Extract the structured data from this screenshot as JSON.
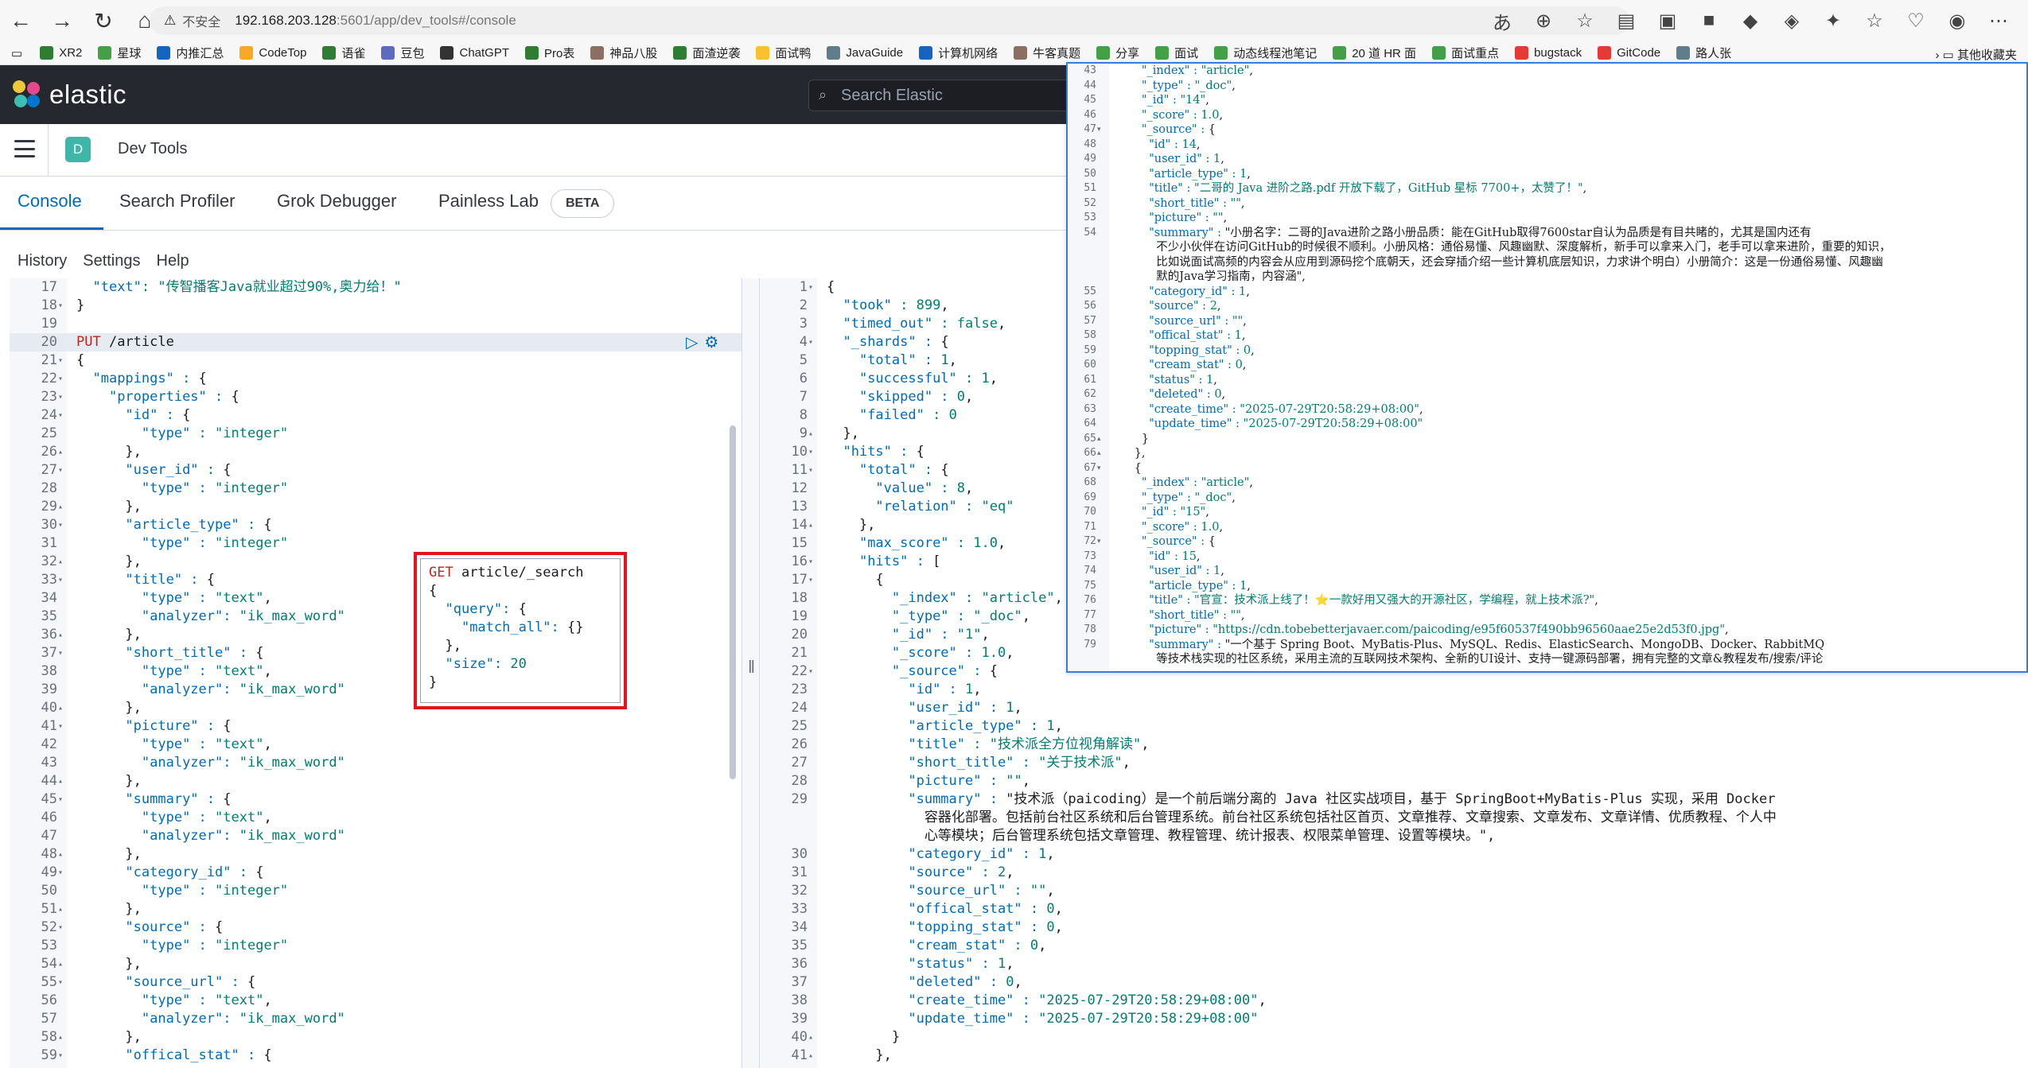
{
  "browser": {
    "insecure_label": "不安全",
    "url_host": "192.168.203.128",
    "url_path": ":5601/app/dev_tools#/console",
    "bookmarks": [
      {
        "label": "XR2",
        "color": "#2e7d32"
      },
      {
        "label": "星球",
        "color": "#43a047"
      },
      {
        "label": "内推汇总",
        "color": "#1565c0"
      },
      {
        "label": "CodeTop",
        "color": "#f9a825"
      },
      {
        "label": "语雀",
        "color": "#2e7d32"
      },
      {
        "label": "豆包",
        "color": "#5c6bc0"
      },
      {
        "label": "ChatGPT",
        "color": "#333333"
      },
      {
        "label": "Pro表",
        "color": "#2e7d32"
      },
      {
        "label": "神品八股",
        "color": "#8d6e63"
      },
      {
        "label": "面渣逆袭",
        "color": "#2e7d32"
      },
      {
        "label": "面试鸭",
        "color": "#fbc02d"
      },
      {
        "label": "JavaGuide",
        "color": "#607d8b"
      },
      {
        "label": "计算机网络",
        "color": "#1565c0"
      },
      {
        "label": "牛客真题",
        "color": "#8d6e63"
      },
      {
        "label": "分享",
        "color": "#43a047"
      },
      {
        "label": "面试",
        "color": "#43a047"
      },
      {
        "label": "动态线程池笔记",
        "color": "#43a047"
      },
      {
        "label": "20 道 HR 面",
        "color": "#43a047"
      },
      {
        "label": "面试重点",
        "color": "#43a047"
      },
      {
        "label": "bugstack",
        "color": "#e53935"
      },
      {
        "label": "GitCode",
        "color": "#e53935"
      },
      {
        "label": "路人张",
        "color": "#607d8b"
      }
    ],
    "other_bookmarks": "其他收藏夹"
  },
  "kibana": {
    "logo_text": "elastic",
    "search_placeholder": "Search Elastic",
    "app_badge": "D",
    "app_title": "Dev Tools",
    "tabs": [
      "Console",
      "Search Profiler",
      "Grok Debugger",
      "Painless Lab"
    ],
    "beta": "BETA",
    "subnav": [
      "History",
      "Settings",
      "Help"
    ]
  },
  "left_editor": [
    {
      "n": "17",
      "f": "",
      "t": "  \"text\": \"传智播客Java就业超过90%,奥力给！\""
    },
    {
      "n": "18",
      "f": "▾",
      "t": "}"
    },
    {
      "n": "19",
      "f": "",
      "t": ""
    },
    {
      "n": "20",
      "f": "",
      "t": "PUT /article",
      "hl": true
    },
    {
      "n": "21",
      "f": "▾",
      "t": "{"
    },
    {
      "n": "22",
      "f": "▾",
      "t": "  \"mappings\" : {"
    },
    {
      "n": "23",
      "f": "▾",
      "t": "    \"properties\" : {"
    },
    {
      "n": "24",
      "f": "▾",
      "t": "      \"id\" : {"
    },
    {
      "n": "25",
      "f": "",
      "t": "        \"type\" : \"integer\""
    },
    {
      "n": "26",
      "f": "▴",
      "t": "      },"
    },
    {
      "n": "27",
      "f": "▾",
      "t": "      \"user_id\" : {"
    },
    {
      "n": "28",
      "f": "",
      "t": "        \"type\" : \"integer\""
    },
    {
      "n": "29",
      "f": "▴",
      "t": "      },"
    },
    {
      "n": "30",
      "f": "▾",
      "t": "      \"article_type\" : {"
    },
    {
      "n": "31",
      "f": "",
      "t": "        \"type\" : \"integer\""
    },
    {
      "n": "32",
      "f": "▴",
      "t": "      },"
    },
    {
      "n": "33",
      "f": "▾",
      "t": "      \"title\" : {"
    },
    {
      "n": "34",
      "f": "",
      "t": "        \"type\" : \"text\","
    },
    {
      "n": "35",
      "f": "",
      "t": "        \"analyzer\": \"ik_max_word\""
    },
    {
      "n": "36",
      "f": "▴",
      "t": "      },"
    },
    {
      "n": "37",
      "f": "▾",
      "t": "      \"short_title\" : {"
    },
    {
      "n": "38",
      "f": "",
      "t": "        \"type\" : \"text\","
    },
    {
      "n": "39",
      "f": "",
      "t": "        \"analyzer\": \"ik_max_word\""
    },
    {
      "n": "40",
      "f": "▴",
      "t": "      },"
    },
    {
      "n": "41",
      "f": "▾",
      "t": "      \"picture\" : {"
    },
    {
      "n": "42",
      "f": "",
      "t": "        \"type\" : \"text\","
    },
    {
      "n": "43",
      "f": "",
      "t": "        \"analyzer\": \"ik_max_word\""
    },
    {
      "n": "44",
      "f": "▴",
      "t": "      },"
    },
    {
      "n": "45",
      "f": "▾",
      "t": "      \"summary\" : {"
    },
    {
      "n": "46",
      "f": "",
      "t": "        \"type\" : \"text\","
    },
    {
      "n": "47",
      "f": "",
      "t": "        \"analyzer\": \"ik_max_word\""
    },
    {
      "n": "48",
      "f": "▴",
      "t": "      },"
    },
    {
      "n": "49",
      "f": "▾",
      "t": "      \"category_id\" : {"
    },
    {
      "n": "50",
      "f": "",
      "t": "        \"type\" : \"integer\""
    },
    {
      "n": "51",
      "f": "▴",
      "t": "      },"
    },
    {
      "n": "52",
      "f": "▾",
      "t": "      \"source\" : {"
    },
    {
      "n": "53",
      "f": "",
      "t": "        \"type\" : \"integer\""
    },
    {
      "n": "54",
      "f": "▴",
      "t": "      },"
    },
    {
      "n": "55",
      "f": "▾",
      "t": "      \"source_url\" : {"
    },
    {
      "n": "56",
      "f": "",
      "t": "        \"type\" : \"text\","
    },
    {
      "n": "57",
      "f": "",
      "t": "        \"analyzer\": \"ik_max_word\""
    },
    {
      "n": "58",
      "f": "▴",
      "t": "      },"
    },
    {
      "n": "59",
      "f": "▾",
      "t": "      \"offical_stat\" : {"
    }
  ],
  "popup_query": [
    "GET article/_search",
    "{",
    "  \"query\": {",
    "    \"match_all\": {}",
    "  },",
    "  \"size\": 20",
    "}"
  ],
  "right_editor": [
    {
      "n": "1",
      "f": "▾",
      "t": "{"
    },
    {
      "n": "2",
      "f": "",
      "t": "  \"took\" : 899,"
    },
    {
      "n": "3",
      "f": "",
      "t": "  \"timed_out\" : false,"
    },
    {
      "n": "4",
      "f": "▾",
      "t": "  \"_shards\" : {"
    },
    {
      "n": "5",
      "f": "",
      "t": "    \"total\" : 1,"
    },
    {
      "n": "6",
      "f": "",
      "t": "    \"successful\" : 1,"
    },
    {
      "n": "7",
      "f": "",
      "t": "    \"skipped\" : 0,"
    },
    {
      "n": "8",
      "f": "",
      "t": "    \"failed\" : 0"
    },
    {
      "n": "9",
      "f": "▴",
      "t": "  },"
    },
    {
      "n": "10",
      "f": "▾",
      "t": "  \"hits\" : {"
    },
    {
      "n": "11",
      "f": "▾",
      "t": "    \"total\" : {"
    },
    {
      "n": "12",
      "f": "",
      "t": "      \"value\" : 8,"
    },
    {
      "n": "13",
      "f": "",
      "t": "      \"relation\" : \"eq\""
    },
    {
      "n": "14",
      "f": "▴",
      "t": "    },"
    },
    {
      "n": "15",
      "f": "",
      "t": "    \"max_score\" : 1.0,"
    },
    {
      "n": "16",
      "f": "▾",
      "t": "    \"hits\" : ["
    },
    {
      "n": "17",
      "f": "▾",
      "t": "      {"
    },
    {
      "n": "18",
      "f": "",
      "t": "        \"_index\" : \"article\","
    },
    {
      "n": "19",
      "f": "",
      "t": "        \"_type\" : \"_doc\","
    },
    {
      "n": "20",
      "f": "",
      "t": "        \"_id\" : \"1\","
    },
    {
      "n": "21",
      "f": "",
      "t": "        \"_score\" : 1.0,"
    },
    {
      "n": "22",
      "f": "▾",
      "t": "        \"_source\" : {"
    },
    {
      "n": "23",
      "f": "",
      "t": "          \"id\" : 1,"
    },
    {
      "n": "24",
      "f": "",
      "t": "          \"user_id\" : 1,"
    },
    {
      "n": "25",
      "f": "",
      "t": "          \"article_type\" : 1,"
    },
    {
      "n": "26",
      "f": "",
      "t": "          \"title\" : \"技术派全方位视角解读\","
    },
    {
      "n": "27",
      "f": "",
      "t": "          \"short_title\" : \"关于技术派\","
    },
    {
      "n": "28",
      "f": "",
      "t": "          \"picture\" : \"\","
    },
    {
      "n": "29",
      "f": "",
      "t": "          \"summary\" : \"技术派（paicoding）是一个前后端分离的 Java 社区实战项目，基于 SpringBoot+MyBatis-Plus 实现，采用 Docker"
    },
    {
      "n": "",
      "f": "",
      "t": "            容器化部署。包括前台社区系统和后台管理系统。前台社区系统包括社区首页、文章推荐、文章搜索、文章发布、文章详情、优质教程、个人中"
    },
    {
      "n": "",
      "f": "",
      "t": "            心等模块；后台管理系统包括文章管理、教程管理、统计报表、权限菜单管理、设置等模块。\","
    },
    {
      "n": "30",
      "f": "",
      "t": "          \"category_id\" : 1,"
    },
    {
      "n": "31",
      "f": "",
      "t": "          \"source\" : 2,"
    },
    {
      "n": "32",
      "f": "",
      "t": "          \"source_url\" : \"\","
    },
    {
      "n": "33",
      "f": "",
      "t": "          \"offical_stat\" : 0,"
    },
    {
      "n": "34",
      "f": "",
      "t": "          \"topping_stat\" : 0,"
    },
    {
      "n": "35",
      "f": "",
      "t": "          \"cream_stat\" : 0,"
    },
    {
      "n": "36",
      "f": "",
      "t": "          \"status\" : 1,"
    },
    {
      "n": "37",
      "f": "",
      "t": "          \"deleted\" : 0,"
    },
    {
      "n": "38",
      "f": "",
      "t": "          \"create_time\" : \"2025-07-29T20:58:29+08:00\","
    },
    {
      "n": "39",
      "f": "",
      "t": "          \"update_time\" : \"2025-07-29T20:58:29+08:00\""
    },
    {
      "n": "40",
      "f": "▴",
      "t": "        }"
    },
    {
      "n": "41",
      "f": "▴",
      "t": "      },"
    }
  ],
  "overlay_editor": [
    {
      "n": "43",
      "f": "",
      "t": "        \"_index\" : \"article\","
    },
    {
      "n": "44",
      "f": "",
      "t": "        \"_type\" : \"_doc\","
    },
    {
      "n": "45",
      "f": "",
      "t": "        \"_id\" : \"14\","
    },
    {
      "n": "46",
      "f": "",
      "t": "        \"_score\" : 1.0,"
    },
    {
      "n": "47",
      "f": "▾",
      "t": "        \"_source\" : {"
    },
    {
      "n": "48",
      "f": "",
      "t": "          \"id\" : 14,"
    },
    {
      "n": "49",
      "f": "",
      "t": "          \"user_id\" : 1,"
    },
    {
      "n": "50",
      "f": "",
      "t": "          \"article_type\" : 1,"
    },
    {
      "n": "51",
      "f": "",
      "t": "          \"title\" : \"二哥的 Java 进阶之路.pdf 开放下载了，GitHub 星标 7700+，太赞了！\","
    },
    {
      "n": "52",
      "f": "",
      "t": "          \"short_title\" : \"\","
    },
    {
      "n": "53",
      "f": "",
      "t": "          \"picture\" : \"\","
    },
    {
      "n": "54",
      "f": "",
      "t": "          \"summary\" : \"小册名字：二哥的Java进阶之路小册品质：能在GitHub取得7600star自认为品质是有目共睹的，尤其是国内还有"
    },
    {
      "n": "",
      "f": "",
      "t": "            不少小伙伴在访问GitHub的时候很不顺利。小册风格：通俗易懂、风趣幽默、深度解析，新手可以拿来入门，老手可以拿来进阶，重要的知识，"
    },
    {
      "n": "",
      "f": "",
      "t": "            比如说面试高频的内容会从应用到源码挖个底朝天，还会穿插介绍一些计算机底层知识，力求讲个明白）小册简介：这是一份通俗易懂、风趣幽"
    },
    {
      "n": "",
      "f": "",
      "t": "            默的Java学习指南，内容涵\","
    },
    {
      "n": "55",
      "f": "",
      "t": "          \"category_id\" : 1,"
    },
    {
      "n": "56",
      "f": "",
      "t": "          \"source\" : 2,"
    },
    {
      "n": "57",
      "f": "",
      "t": "          \"source_url\" : \"\","
    },
    {
      "n": "58",
      "f": "",
      "t": "          \"offical_stat\" : 1,"
    },
    {
      "n": "59",
      "f": "",
      "t": "          \"topping_stat\" : 0,"
    },
    {
      "n": "60",
      "f": "",
      "t": "          \"cream_stat\" : 0,"
    },
    {
      "n": "61",
      "f": "",
      "t": "          \"status\" : 1,"
    },
    {
      "n": "62",
      "f": "",
      "t": "          \"deleted\" : 0,"
    },
    {
      "n": "63",
      "f": "",
      "t": "          \"create_time\" : \"2025-07-29T20:58:29+08:00\","
    },
    {
      "n": "64",
      "f": "",
      "t": "          \"update_time\" : \"2025-07-29T20:58:29+08:00\""
    },
    {
      "n": "65",
      "f": "▴",
      "t": "        }"
    },
    {
      "n": "66",
      "f": "▴",
      "t": "      },"
    },
    {
      "n": "67",
      "f": "▾",
      "t": "      {"
    },
    {
      "n": "68",
      "f": "",
      "t": "        \"_index\" : \"article\","
    },
    {
      "n": "69",
      "f": "",
      "t": "        \"_type\" : \"_doc\","
    },
    {
      "n": "70",
      "f": "",
      "t": "        \"_id\" : \"15\","
    },
    {
      "n": "71",
      "f": "",
      "t": "        \"_score\" : 1.0,"
    },
    {
      "n": "72",
      "f": "▾",
      "t": "        \"_source\" : {"
    },
    {
      "n": "73",
      "f": "",
      "t": "          \"id\" : 15,"
    },
    {
      "n": "74",
      "f": "",
      "t": "          \"user_id\" : 1,"
    },
    {
      "n": "75",
      "f": "",
      "t": "          \"article_type\" : 1,"
    },
    {
      "n": "76",
      "f": "",
      "t": "          \"title\" : \"官宣：技术派上线了！⭐一款好用又强大的开源社区，学编程，就上技术派?\","
    },
    {
      "n": "77",
      "f": "",
      "t": "          \"short_title\" : \"\","
    },
    {
      "n": "78",
      "f": "",
      "t": "          \"picture\" : \"https://cdn.tobebetterjavaer.com/paicoding/e95f60537f490bb96560aae25e2d53f0.jpg\","
    },
    {
      "n": "79",
      "f": "",
      "t": "          \"summary\" : \"一个基于 Spring Boot、MyBatis-Plus、MySQL、Redis、ElasticSearch、MongoDB、Docker、RabbitMQ"
    },
    {
      "n": "",
      "f": "",
      "t": "            等技术栈实现的社区系统，采用主流的互联网技术架构、全新的UI设计、支持一键源码部署，拥有完整的文章&教程发布/搜索/评论"
    }
  ],
  "colors": {
    "header_bg": "#25282f",
    "accent": "#006bb8",
    "highlight_border": "#e0161c",
    "string": "#017d73",
    "keyword": "#bd271e"
  }
}
